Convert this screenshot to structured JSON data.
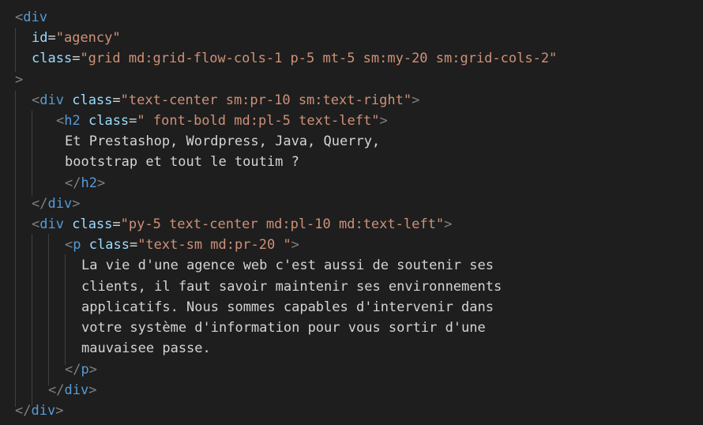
{
  "editor": {
    "colors": {
      "background": "#1e1e1e",
      "tag": "#569cd6",
      "bracket": "#808080",
      "attribute": "#9cdcfe",
      "string": "#ce9178",
      "text": "#d4d4d4",
      "indent_guide": "#404040"
    },
    "lines": [
      {
        "tokens": [
          {
            "k": "punct",
            "t": "<"
          },
          {
            "k": "tag",
            "t": "div"
          }
        ]
      },
      {
        "tokens": [
          {
            "k": "attr",
            "t": "id"
          },
          {
            "k": "eq",
            "t": "="
          },
          {
            "k": "str",
            "t": "\"agency\""
          }
        ]
      },
      {
        "tokens": [
          {
            "k": "attr",
            "t": "class"
          },
          {
            "k": "eq",
            "t": "="
          },
          {
            "k": "str",
            "t": "\"grid md:grid-flow-cols-1 p-5 mt-5 sm:my-20 sm:grid-cols-2\""
          }
        ]
      },
      {
        "tokens": [
          {
            "k": "punct",
            "t": ">"
          }
        ]
      },
      {
        "tokens": [
          {
            "k": "punct",
            "t": "<"
          },
          {
            "k": "tag",
            "t": "div"
          },
          {
            "k": "eq",
            "t": " "
          },
          {
            "k": "attr",
            "t": "class"
          },
          {
            "k": "eq",
            "t": "="
          },
          {
            "k": "str",
            "t": "\"text-center sm:pr-10 sm:text-right\""
          },
          {
            "k": "punct",
            "t": ">"
          }
        ]
      },
      {
        "tokens": [
          {
            "k": "punct",
            "t": "<"
          },
          {
            "k": "tag",
            "t": "h2"
          },
          {
            "k": "eq",
            "t": " "
          },
          {
            "k": "attr",
            "t": "class"
          },
          {
            "k": "eq",
            "t": "="
          },
          {
            "k": "str",
            "t": "\" font-bold md:pl-5 text-left\""
          },
          {
            "k": "punct",
            "t": ">"
          }
        ]
      },
      {
        "tokens": [
          {
            "k": "txt",
            "t": "Et Prestashop, Wordpress, Java, Querry,"
          }
        ]
      },
      {
        "tokens": [
          {
            "k": "txt",
            "t": "bootstrap et tout le toutim ?"
          }
        ]
      },
      {
        "tokens": [
          {
            "k": "punct",
            "t": "</"
          },
          {
            "k": "tag",
            "t": "h2"
          },
          {
            "k": "punct",
            "t": ">"
          }
        ]
      },
      {
        "tokens": [
          {
            "k": "punct",
            "t": "</"
          },
          {
            "k": "tag",
            "t": "div"
          },
          {
            "k": "punct",
            "t": ">"
          }
        ]
      },
      {
        "tokens": [
          {
            "k": "punct",
            "t": "<"
          },
          {
            "k": "tag",
            "t": "div"
          },
          {
            "k": "eq",
            "t": " "
          },
          {
            "k": "attr",
            "t": "class"
          },
          {
            "k": "eq",
            "t": "="
          },
          {
            "k": "str",
            "t": "\"py-5 text-center md:pl-10 md:text-left\""
          },
          {
            "k": "punct",
            "t": ">"
          }
        ]
      },
      {
        "tokens": [
          {
            "k": "punct",
            "t": "<"
          },
          {
            "k": "tag",
            "t": "p"
          },
          {
            "k": "eq",
            "t": " "
          },
          {
            "k": "attr",
            "t": "class"
          },
          {
            "k": "eq",
            "t": "="
          },
          {
            "k": "str",
            "t": "\"text-sm md:pr-20 \""
          },
          {
            "k": "punct",
            "t": ">"
          }
        ]
      },
      {
        "tokens": [
          {
            "k": "txt",
            "t": "La vie d'une agence web c'est aussi de soutenir ses"
          }
        ]
      },
      {
        "tokens": [
          {
            "k": "txt",
            "t": "clients, il faut savoir maintenir ses environnements"
          }
        ]
      },
      {
        "tokens": [
          {
            "k": "txt",
            "t": "applicatifs. Nous sommes capables d'intervenir dans"
          }
        ]
      },
      {
        "tokens": [
          {
            "k": "txt",
            "t": "votre système d'information pour vous sortir d'une"
          }
        ]
      },
      {
        "tokens": [
          {
            "k": "txt",
            "t": "mauvaisee passe."
          }
        ]
      },
      {
        "tokens": [
          {
            "k": "punct",
            "t": "</"
          },
          {
            "k": "tag",
            "t": "p"
          },
          {
            "k": "punct",
            "t": ">"
          }
        ]
      },
      {
        "tokens": [
          {
            "k": "punct",
            "t": "</"
          },
          {
            "k": "tag",
            "t": "div"
          },
          {
            "k": "punct",
            "t": ">"
          }
        ]
      },
      {
        "tokens": [
          {
            "k": "punct",
            "t": "</"
          },
          {
            "k": "tag",
            "t": "div"
          },
          {
            "k": "punct",
            "t": ">"
          }
        ]
      }
    ]
  }
}
